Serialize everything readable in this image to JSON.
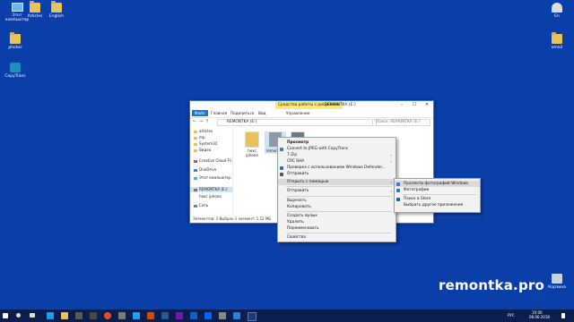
{
  "desktop": {
    "icons": [
      {
        "label": "Этот компьютер",
        "type": "pc"
      },
      {
        "label": "Articles",
        "type": "folder"
      },
      {
        "label": "English",
        "type": "folder"
      },
      {
        "label": "photos",
        "type": "folder"
      },
      {
        "label": "CopyTrans",
        "type": "app"
      },
      {
        "label": "En",
        "type": "folder"
      },
      {
        "label": "email",
        "type": "folder"
      },
      {
        "label": "Корзина",
        "type": "bin"
      }
    ],
    "watermark": "remontka.pro"
  },
  "explorer": {
    "title": "REMONTKA (E:)",
    "context_tab": "Средства работы с рисунками",
    "ribbon_tabs": [
      "Файл",
      "Главная",
      "Поделиться",
      "Вид",
      "Управление"
    ],
    "address": "REMONTKA (E:)",
    "search_placeholder": "Поиск: REMONTKA (E:)",
    "nav_items": [
      "articles",
      "mp",
      "System32",
      "Видео",
      "Creative Cloud Fil",
      "OneDrive",
      "Этот компьютер",
      "REMONTKA (E:)",
      "hexc iphone",
      "Сеть"
    ],
    "files": [
      {
        "label": "hexc iphone"
      },
      {
        "label": "remont ka"
      },
      {
        "label": ""
      }
    ],
    "status": "Элементов: 3     Выбран 1 элемент: 1,52 МБ"
  },
  "context_menu": {
    "items": [
      {
        "label": "Просмотр",
        "bold": true,
        "arrow": false
      },
      {
        "label": "Convert to JPEG with CopyTrans",
        "arrow": false
      },
      {
        "label": "7-Zip",
        "arrow": true
      },
      {
        "label": "CRC SHA",
        "arrow": true
      },
      {
        "label": "Проверка с использованием Windows Defender...",
        "arrow": false
      },
      {
        "label": "Отправить",
        "arrow": false
      },
      {
        "label": "Открыть с помощью",
        "arrow": true
      },
      {
        "label": "Отправить",
        "arrow": true
      },
      {
        "label": "Вырезать",
        "arrow": false
      },
      {
        "label": "Копировать",
        "arrow": false
      },
      {
        "label": "Создать ярлык",
        "arrow": false
      },
      {
        "label": "Удалить",
        "arrow": false
      },
      {
        "label": "Переименовать",
        "arrow": false
      },
      {
        "label": "Свойства",
        "arrow": false
      }
    ]
  },
  "submenu": {
    "items": [
      {
        "label": "Просмотр фотографий Windows"
      },
      {
        "label": "Фотографии"
      },
      {
        "label": "Поиск в Store"
      },
      {
        "label": "Выбрать другое приложение"
      }
    ]
  },
  "taskbar": {
    "lang": "РУС",
    "time": "10:00",
    "date": "08.06.2018"
  },
  "colors": {
    "desktop": "#0a3ea9",
    "accent": "#1979ca",
    "taskbar": "#0b1e4e"
  }
}
